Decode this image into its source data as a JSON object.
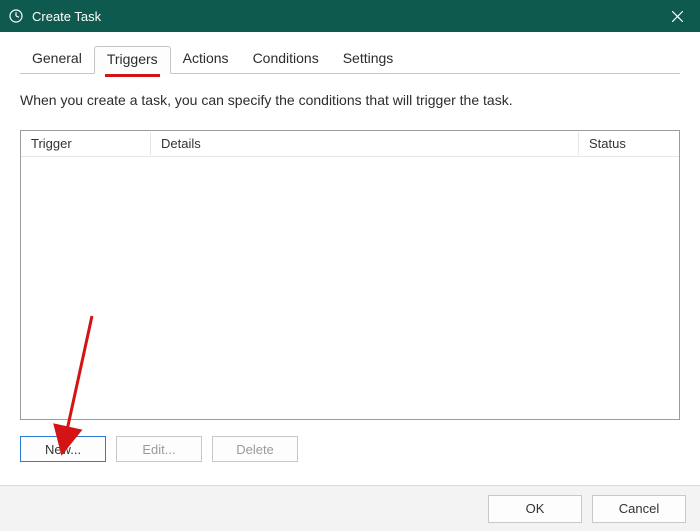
{
  "window": {
    "title": "Create Task"
  },
  "tabs": {
    "general": "General",
    "triggers": "Triggers",
    "actions": "Actions",
    "conditions": "Conditions",
    "settings": "Settings",
    "active": "triggers"
  },
  "description": "When you create a task, you can specify the conditions that will trigger the task.",
  "listview": {
    "columns": {
      "trigger": "Trigger",
      "details": "Details",
      "status": "Status"
    },
    "rows": []
  },
  "buttons": {
    "new": "New...",
    "edit": "Edit...",
    "delete": "Delete"
  },
  "footer": {
    "ok": "OK",
    "cancel": "Cancel"
  },
  "colors": {
    "titlebar": "#0f5a4f",
    "highlight": "#d41414",
    "primary_border": "#2a7bd6"
  }
}
